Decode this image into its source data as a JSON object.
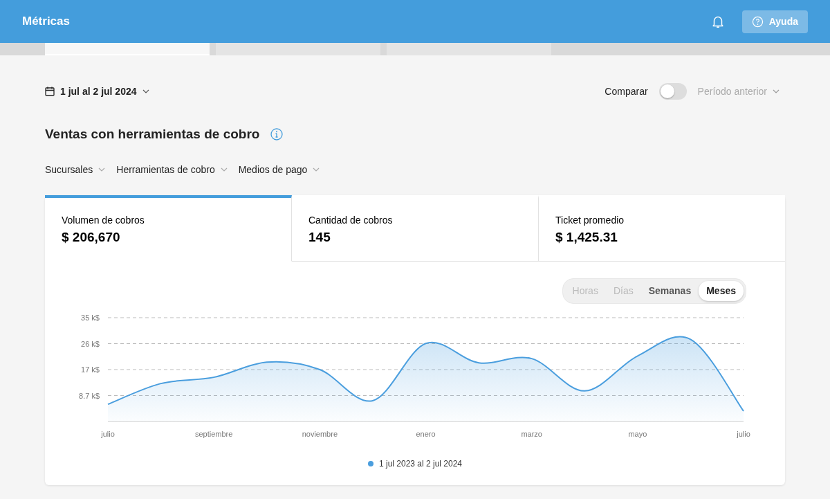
{
  "header": {
    "title": "Métricas",
    "help_button": "Ayuda"
  },
  "top_tabs": [
    {
      "selected": true
    },
    {
      "selected": false
    },
    {
      "selected": false
    }
  ],
  "date_range": "1 jul al 2 jul 2024",
  "compare": {
    "label": "Comparar",
    "on": false,
    "period": "Período anterior",
    "period_disabled": true
  },
  "section_title": "Ventas con herramientas de cobro",
  "filters": [
    "Sucursales",
    "Herramientas de cobro",
    "Medios de pago"
  ],
  "metrics": [
    {
      "label": "Volumen de cobros",
      "value": "$ 206,670",
      "selected": true
    },
    {
      "label": "Cantidad de cobros",
      "value": "145",
      "selected": false
    },
    {
      "label": "Ticket promedio",
      "value": "$ 1,425.31",
      "selected": false
    }
  ],
  "granularity": [
    {
      "label": "Horas",
      "disabled": true,
      "selected": false
    },
    {
      "label": "Días",
      "disabled": true,
      "selected": false
    },
    {
      "label": "Semanas",
      "disabled": false,
      "selected": false
    },
    {
      "label": "Meses",
      "disabled": false,
      "selected": true
    }
  ],
  "chart_data": {
    "type": "area",
    "grid": true,
    "categories": [
      "julio",
      null,
      "septiembre",
      null,
      "noviembre",
      null,
      "enero",
      null,
      "marzo",
      null,
      "mayo",
      null,
      "julio"
    ],
    "ylim": [
      0,
      35
    ],
    "yticks": [
      {
        "value": 8.75,
        "label": "8.7 k$"
      },
      {
        "value": 17.5,
        "label": "17 k$"
      },
      {
        "value": 26.25,
        "label": "26 k$"
      },
      {
        "value": 35,
        "label": "35 k$"
      }
    ],
    "series": [
      {
        "name": "1 jul 2023 al 2 jul 2024",
        "color": "#4a9ede",
        "values": [
          5.8,
          12.8,
          14.9,
          20,
          17.5,
          7,
          26.3,
          19.8,
          21.2,
          10.3,
          22.1,
          27.7,
          3.5
        ]
      }
    ]
  }
}
